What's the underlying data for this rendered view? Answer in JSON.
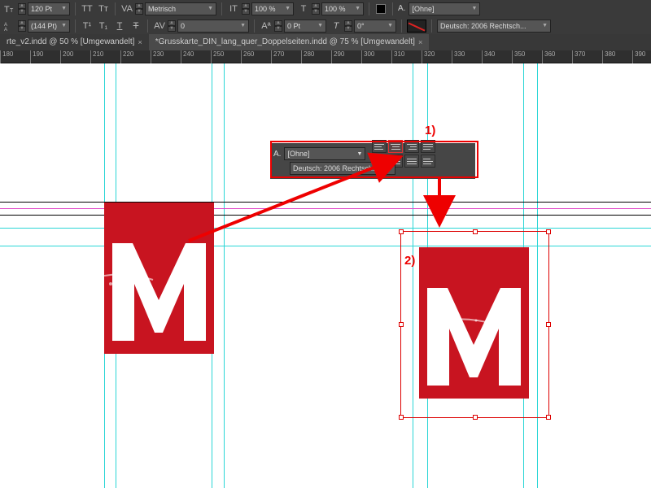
{
  "toolbar": {
    "font_size": "120 Pt",
    "leading": "(144 Pt)",
    "kerning": "Metrisch",
    "tracking": "0",
    "h_scale": "100 %",
    "v_scale": "100 %",
    "baseline": "0 Pt",
    "skew": "0°",
    "para_style_label": "A.",
    "para_style": "[Ohne]",
    "language": "Deutsch: 2006 Rechtsch..."
  },
  "tabs": {
    "tab1": "rte_v2.indd @ 50 % [Umgewandelt]",
    "tab2": "*Grusskarte_DIN_lang_quer_Doppelseiten.indd @ 75 % [Umgewandelt]"
  },
  "ruler": [
    "180",
    "190",
    "200",
    "210",
    "220",
    "230",
    "240",
    "250",
    "260",
    "270",
    "280",
    "290",
    "300",
    "310",
    "320",
    "330",
    "340",
    "350",
    "360",
    "370",
    "380",
    "390"
  ],
  "flypanel": {
    "label": "A.",
    "style": "[Ohne]",
    "language": "Deutsch: 2006 Rechtsch..."
  },
  "annotations": {
    "one": "1)",
    "two": "2)"
  }
}
